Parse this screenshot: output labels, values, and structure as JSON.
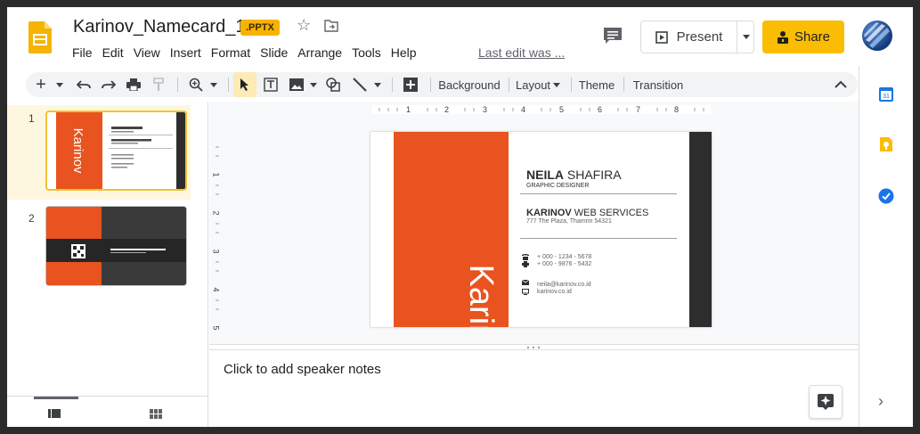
{
  "header": {
    "doc_title": "Karinov_Namecard_1",
    "badge": ".PPTX",
    "menu": [
      "File",
      "Edit",
      "View",
      "Insert",
      "Format",
      "Slide",
      "Arrange",
      "Tools",
      "Help"
    ],
    "last_edit": "Last edit was ...",
    "present_label": "Present",
    "share_label": "Share"
  },
  "toolbar": {
    "background_label": "Background",
    "layout_label": "Layout",
    "theme_label": "Theme",
    "transition_label": "Transition"
  },
  "filmstrip": {
    "slide1_num": "1",
    "slide2_num": "2"
  },
  "rulers": {
    "h_ticks": [
      "1",
      "2",
      "3",
      "4",
      "5",
      "6",
      "7",
      "8"
    ],
    "v_ticks": [
      "1",
      "2",
      "3",
      "4",
      "5"
    ]
  },
  "slide": {
    "brand": "Karinov",
    "name_first": "NEILA",
    "name_last": " SHAFIRA",
    "role": "GRAPHIC DESIGNER",
    "company_bold": "KARINOV",
    "company_rest": " WEB SERVICES",
    "address": "777 The Plaza, Thamrin 54321",
    "phone1": "+ 000 - 1234 - 5678",
    "phone2": "+ 000 - 9876 - 5432",
    "email": "neila@karinov.co.id",
    "website": "karinov.co.id"
  },
  "thumb2": {
    "company": "KARINOV WEB SERVICES"
  },
  "notes": {
    "placeholder": "Click to add speaker notes"
  },
  "colors": {
    "accent_orange": "#e8531f",
    "share_yellow": "#fbbc04",
    "dark": "#2d2d2d"
  }
}
